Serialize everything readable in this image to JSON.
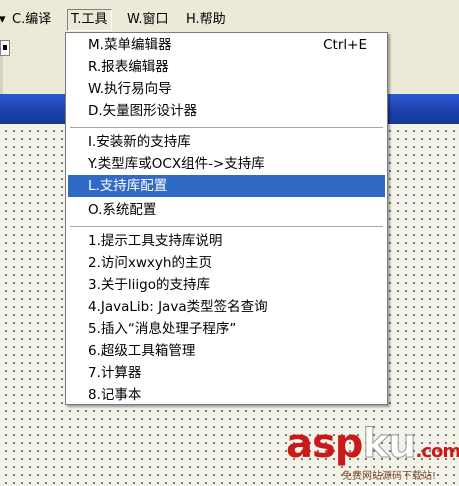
{
  "menubar": {
    "items": [
      {
        "prefix": "▾",
        "label": ""
      },
      {
        "label": "C.编译"
      },
      {
        "label": "T.工具"
      },
      {
        "label": "W.窗口"
      },
      {
        "label": "H.帮助"
      }
    ]
  },
  "tools_menu": {
    "groups": [
      [
        {
          "label": "M.菜单编辑器",
          "shortcut": "Ctrl+E"
        },
        {
          "label": "R.报表编辑器"
        },
        {
          "label": "W.执行易向导"
        },
        {
          "label": "D.矢量图形设计器"
        }
      ],
      [
        {
          "label": "I.安装新的支持库"
        },
        {
          "label": "Y.类型库或OCX组件->支持库"
        },
        {
          "label": "L.支持库配置",
          "selected": true
        },
        {
          "label": "O.系统配置"
        }
      ],
      [
        {
          "label": "1.提示工具支持库说明"
        },
        {
          "label": "2.访问xwxyh的主页"
        },
        {
          "label": "3.关于liigo的支持库"
        },
        {
          "label": "4.JavaLib: Java类型签名查询"
        },
        {
          "label": "5.插入“消息处理子程序”"
        },
        {
          "label": "6.超级工具箱管理"
        },
        {
          "label": "7.计算器"
        },
        {
          "label": "8.记事本"
        }
      ]
    ]
  },
  "watermark": {
    "brand_a": "asp",
    "brand_b": "ku",
    "brand_c": ".com",
    "subtitle": "免费网站源码下载站!"
  },
  "colors": {
    "selection": "#316AC5",
    "menubar": "#ECE9D8",
    "titlebar": "#1b3fa8"
  }
}
